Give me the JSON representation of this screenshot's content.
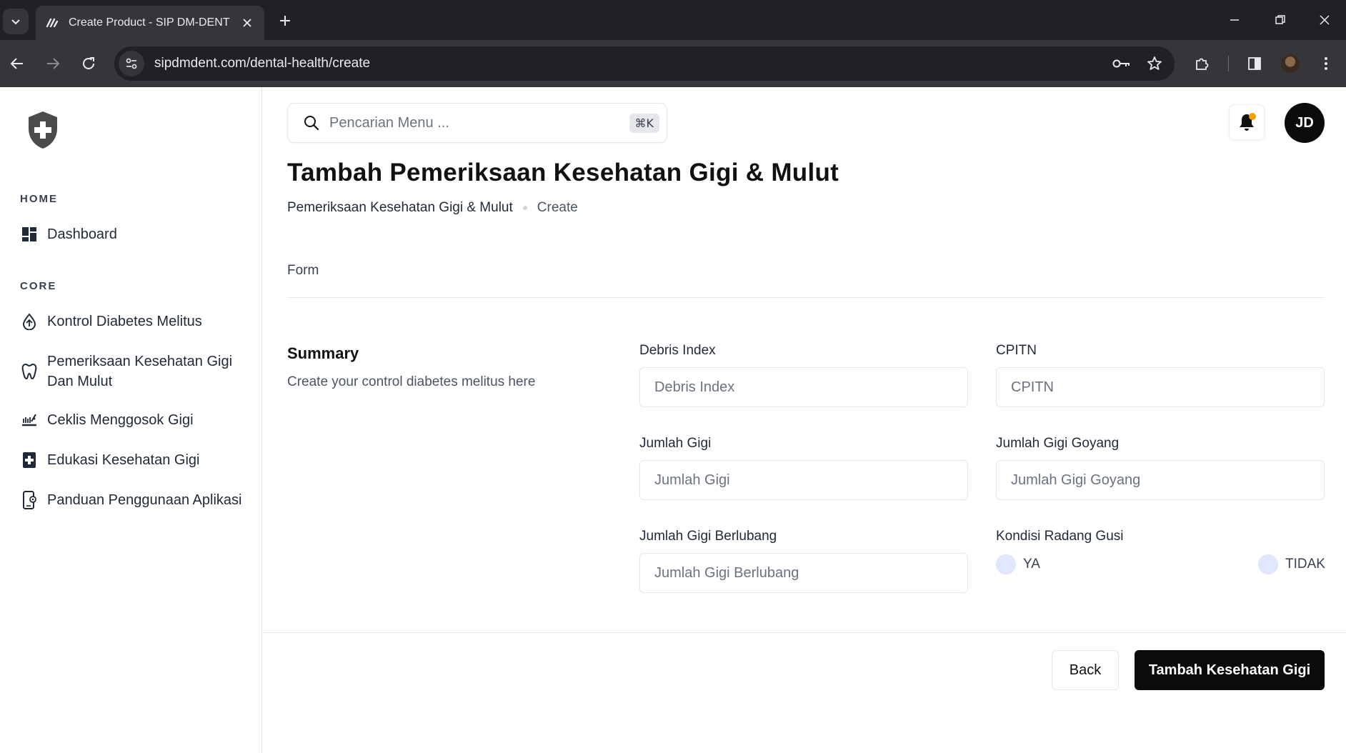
{
  "browser": {
    "tab_title": "Create Product - SIP DM-DENT",
    "url": "sipdmdent.com/dental-health/create"
  },
  "sidebar": {
    "sections": [
      {
        "label": "HOME"
      },
      {
        "label": "CORE"
      }
    ],
    "items": [
      {
        "label": "Dashboard",
        "icon": "dashboard-icon"
      },
      {
        "label": "Kontrol Diabetes Melitus",
        "icon": "droplet-icon"
      },
      {
        "label": "Pemeriksaan Kesehatan Gigi Dan Mulut",
        "icon": "tooth-icon"
      },
      {
        "label": "Ceklis Menggosok Gigi",
        "icon": "toothbrush-icon"
      },
      {
        "label": "Edukasi Kesehatan Gigi",
        "icon": "medical-book-icon"
      },
      {
        "label": "Panduan Penggunaan Aplikasi",
        "icon": "phone-guide-icon"
      }
    ]
  },
  "header": {
    "search_placeholder": "Pencarian Menu ...",
    "search_shortcut": "⌘K",
    "avatar_initials": "JD"
  },
  "page": {
    "title": "Tambah Pemeriksaan Kesehatan Gigi & Mulut",
    "breadcrumb": [
      "Pemeriksaan Kesehatan Gigi & Mulut",
      "Create"
    ],
    "form_tab": "Form",
    "summary_title": "Summary",
    "summary_desc": "Create your control diabetes melitus here"
  },
  "form": {
    "debris": {
      "label": "Debris Index",
      "placeholder": "Debris Index",
      "value": ""
    },
    "cpitn": {
      "label": "CPITN",
      "placeholder": "CPITN",
      "value": ""
    },
    "jumlah_gigi": {
      "label": "Jumlah Gigi",
      "placeholder": "Jumlah Gigi",
      "value": ""
    },
    "gigi_goyang": {
      "label": "Jumlah Gigi Goyang",
      "placeholder": "Jumlah Gigi Goyang",
      "value": ""
    },
    "gigi_berlubang": {
      "label": "Jumlah Gigi Berlubang",
      "placeholder": "Jumlah Gigi Berlubang",
      "value": ""
    },
    "radang_gusi": {
      "label": "Kondisi Radang Gusi",
      "options": [
        "YA",
        "TIDAK"
      ],
      "selected": ""
    }
  },
  "actions": {
    "back_label": "Back",
    "submit_label": "Tambah Kesehatan Gigi"
  },
  "colors": {
    "primary": "#0b0b0b",
    "notification_dot": "#f59e0b",
    "radio_fill": "#e0e7ff"
  }
}
